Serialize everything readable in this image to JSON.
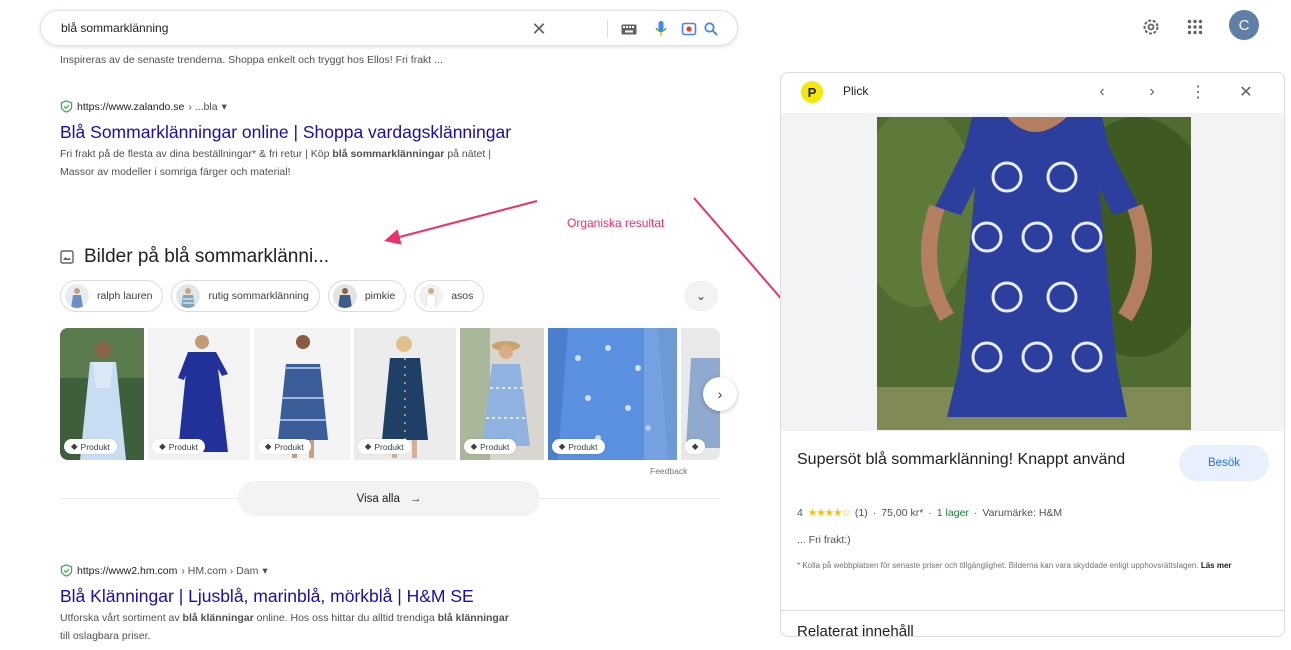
{
  "search": {
    "query": "blå sommarklänning",
    "clear_icon": "close-icon",
    "keyboard_icon": "keyboard-icon",
    "mic_icon": "mic-icon",
    "lens_icon": "camera-lens-icon",
    "search_icon": "search-icon"
  },
  "account": {
    "avatar_letter": "C"
  },
  "cut_snippet": "Inspireras av de senaste trenderna. Shoppa enkelt och tryggt hos Ellos! Fri frakt ...",
  "results": [
    {
      "url": "https://www.zalando.se",
      "crumb": "› ...bla",
      "title": "Blå Sommarklänningar online | Shoppa vardagsklänningar",
      "snippet_line1_a": "Fri frakt på de flesta av dina beställningar* & fri retur | Köp ",
      "snippet_line1_b": "blå sommarklänningar",
      "snippet_line1_c": " på nätet |",
      "snippet_line2": "Massor av modeller i somriga färger och material!"
    },
    {
      "url": "https://www2.hm.com",
      "crumb": "› HM.com › Dam",
      "title": "Blå Klänningar | Ljusblå, marinblå, mörkblå | H&M SE",
      "snippet_line1_a": "Utforska vårt sortiment av ",
      "snippet_line1_b": "blå klänningar",
      "snippet_line1_c": " online. Hos oss hittar du alltid trendiga ",
      "snippet_line1_d": "blå klänningar",
      "snippet_line2": "till oslagbara priser."
    }
  ],
  "images": {
    "heading": "Bilder på blå sommarklänni...",
    "chips": [
      "ralph lauren",
      "rutig sommarklänning",
      "pimkie",
      "asos"
    ],
    "badge": "Produkt",
    "feedback": "Feedback",
    "show_all": "Visa alla"
  },
  "annotation": {
    "text": "Organiska resultat",
    "color": "#e8336b"
  },
  "panel": {
    "source": "Plick",
    "title": "Supersöt blå sommarklänning! Knappt använd",
    "visit": "Besök",
    "rating": "4",
    "stars": "★★★★☆",
    "reviews": "(1)",
    "price": "75,00 kr*",
    "stock": "1 lager",
    "brand": "Varumärke: H&M",
    "desc": "... Fri frakt:)",
    "note": "* Kolla på webbplatsen för senaste priser och tillgänglighet. Bilderna kan vara skyddade enligt upphovsrättslagen.",
    "note_link": "Läs mer",
    "related": "Relaterat innehåll"
  },
  "colors": {
    "link": "#1a0dab",
    "accent": "#1a73e8",
    "annotation": "#e8336b"
  }
}
